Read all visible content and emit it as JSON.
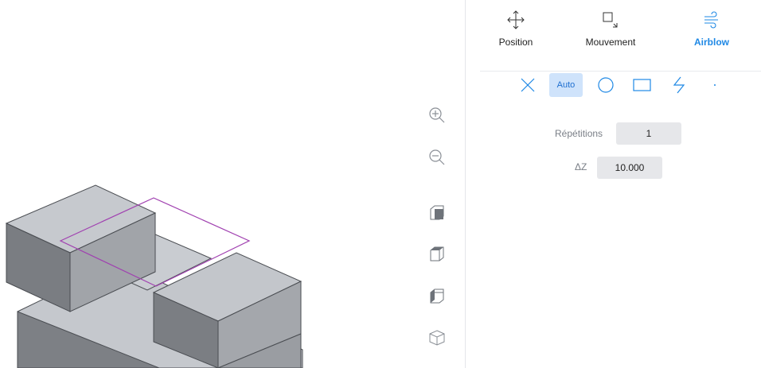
{
  "tabs": [
    {
      "label": "Position",
      "icon": "move-arrows-icon",
      "active": false
    },
    {
      "label": "Mouvement",
      "icon": "square-arrow-icon",
      "active": false
    },
    {
      "label": "Airblow",
      "icon": "wind-icon",
      "active": true
    }
  ],
  "modes": {
    "auto_label": "Auto",
    "selected": "Auto",
    "items": [
      "x-icon",
      "auto",
      "circle-icon",
      "rectangle-icon",
      "lightning-icon",
      "dot-icon"
    ]
  },
  "fields": {
    "repetitions_label": "Répétitions",
    "repetitions_value": "1",
    "dz_label": "ΔZ",
    "dz_value": "10.000"
  },
  "view_tools": [
    "zoom-in-icon",
    "zoom-out-icon",
    "view-top-cube-icon",
    "view-front-cube-icon",
    "view-side-cube-icon",
    "view-iso-cube-icon"
  ],
  "colors": {
    "accent": "#1e88e5",
    "selection_outline": "#a040b0",
    "box_face": "#b4b7bc"
  }
}
